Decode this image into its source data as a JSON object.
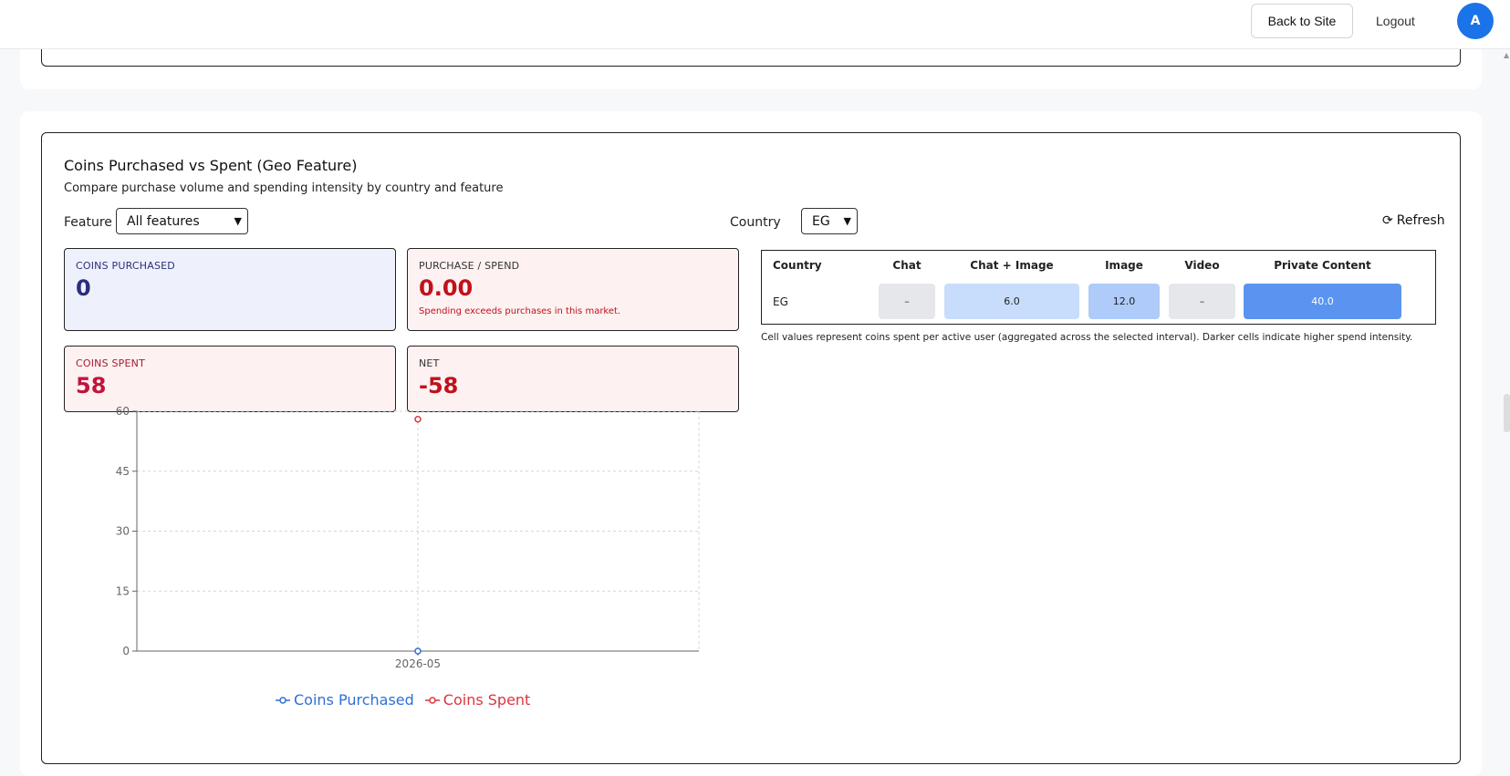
{
  "topbar": {
    "back_label": "Back to Site",
    "logout_label": "Logout",
    "avatar_letter": "A"
  },
  "section": {
    "title": "Coins Purchased vs Spent (Geo Feature)",
    "subtitle": "Compare purchase volume and spending intensity by country and feature"
  },
  "filters": {
    "feature_label": "Feature",
    "feature_value": "All features",
    "country_label": "Country",
    "country_value": "EG",
    "refresh_label": "Refresh"
  },
  "stats": {
    "purchased": {
      "label": "COINS PURCHASED",
      "value": "0"
    },
    "ratio": {
      "label": "PURCHASE / SPEND",
      "value": "0.00",
      "note": "Spending exceeds purchases in this market."
    },
    "spent": {
      "label": "COINS SPENT",
      "value": "58"
    },
    "net": {
      "label": "NET",
      "value": "-58"
    }
  },
  "heatmap": {
    "headers": [
      "Country",
      "Chat",
      "Chat + Image",
      "Image",
      "Video",
      "Private Content"
    ],
    "row": {
      "country": "EG",
      "cells": [
        "–",
        "6.0",
        "12.0",
        "–",
        "40.0"
      ]
    },
    "note": "Cell values represent coins spent per active user (aggregated across the selected interval). Darker cells indicate higher spend intensity."
  },
  "chart_data": {
    "type": "line",
    "x": [
      "2026-05"
    ],
    "series": [
      {
        "name": "Coins Purchased",
        "values": [
          0
        ],
        "color": "#2f6fd6"
      },
      {
        "name": "Coins Spent",
        "values": [
          58
        ],
        "color": "#d9363e"
      }
    ],
    "yticks": [
      0,
      15,
      30,
      45,
      60
    ],
    "ylim": [
      0,
      60
    ],
    "grid": true,
    "legend": "bottom"
  },
  "colors": {
    "accent": "#1a73e8",
    "purchased": "#2f6fd6",
    "spent": "#d9363e"
  }
}
